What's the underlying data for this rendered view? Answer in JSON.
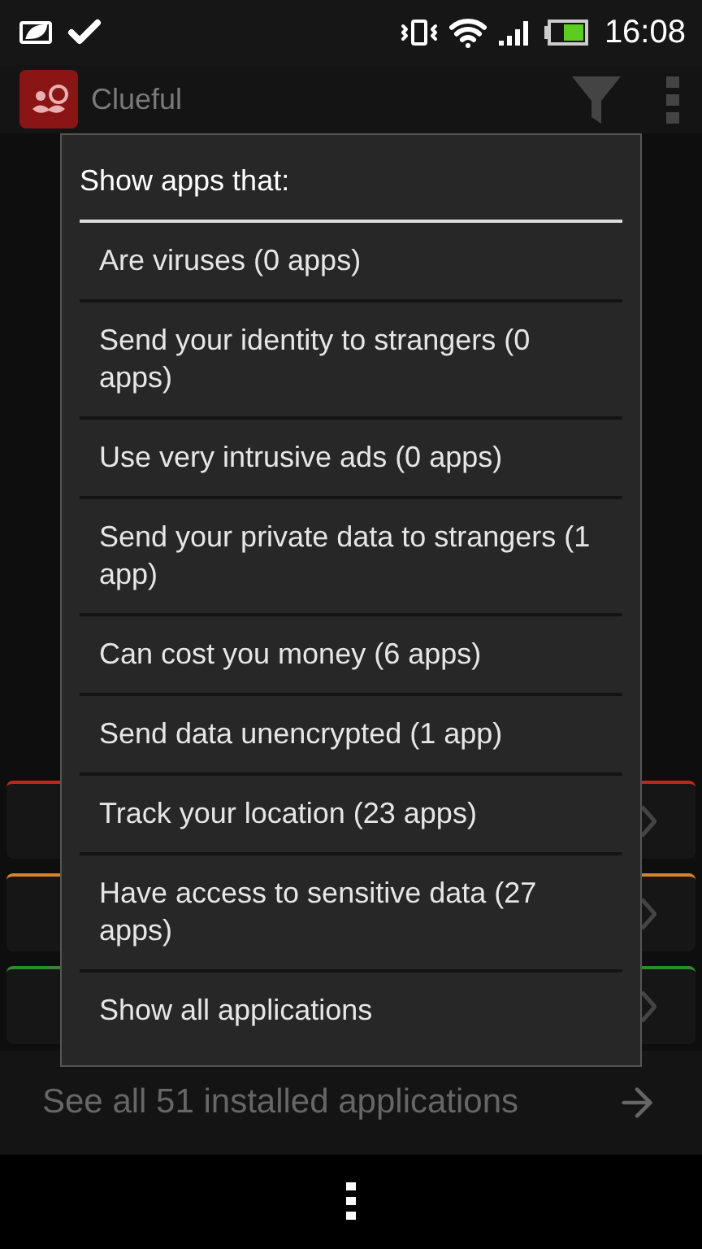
{
  "status_bar": {
    "time": "16:08"
  },
  "app_bar": {
    "title": "Clueful"
  },
  "background_cards": [
    {
      "color": "#c0261e"
    },
    {
      "color": "#d9822b"
    },
    {
      "color": "#2f8a2f"
    }
  ],
  "footer": {
    "label": "See all 51 installed applications"
  },
  "dialog": {
    "title": "Show apps that:",
    "items": [
      {
        "label": "Are viruses (0 apps)"
      },
      {
        "label": "Send your identity to strangers (0 apps)"
      },
      {
        "label": "Use very intrusive ads (0 apps)"
      },
      {
        "label": "Send your private data to strangers (1 app)"
      },
      {
        "label": "Can cost you money (6 apps)"
      },
      {
        "label": "Send data unencrypted (1 app)"
      },
      {
        "label": "Track your location (23 apps)"
      },
      {
        "label": "Have access to sensitive data (27 apps)"
      },
      {
        "label": "Show all applications"
      }
    ]
  }
}
